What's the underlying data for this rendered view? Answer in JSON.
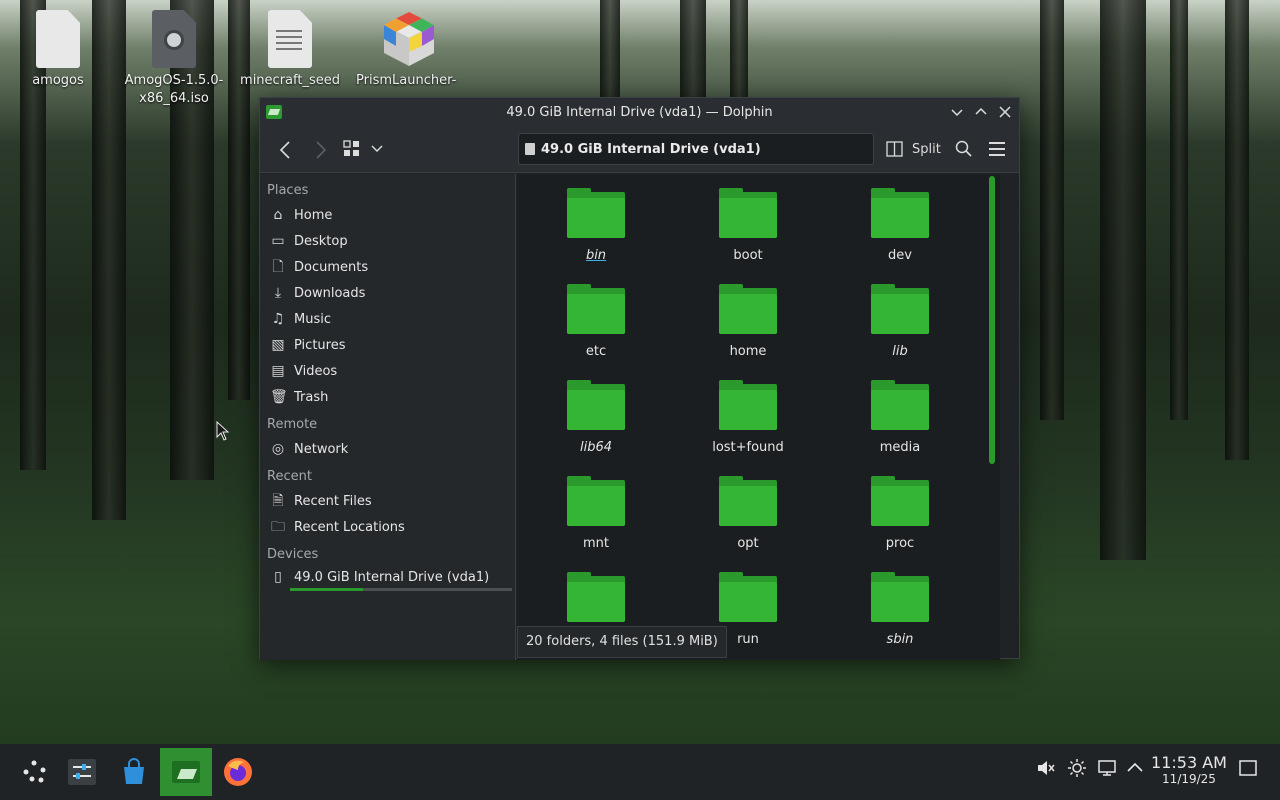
{
  "desktop": {
    "icons": [
      {
        "label": "amogos",
        "icon": "document-icon"
      },
      {
        "label": "AmogOS-1.5.0-x86_64.iso",
        "icon": "disc-image-icon"
      },
      {
        "label": "minecraft_seed",
        "icon": "text-document-icon"
      },
      {
        "label": "PrismLauncher-",
        "icon": "prism-launcher-icon"
      }
    ]
  },
  "window": {
    "title": "49.0 GiB Internal Drive (vda1) — Dolphin",
    "controls": [
      "minimize",
      "maximize",
      "close"
    ]
  },
  "toolbar": {
    "address": "49.0 GiB Internal Drive (vda1)",
    "split_label": "Split"
  },
  "sidebar": {
    "places_title": "Places",
    "places": [
      {
        "label": "Home",
        "icon": "home-icon"
      },
      {
        "label": "Desktop",
        "icon": "desktop-icon"
      },
      {
        "label": "Documents",
        "icon": "documents-icon"
      },
      {
        "label": "Downloads",
        "icon": "downloads-icon"
      },
      {
        "label": "Music",
        "icon": "music-icon"
      },
      {
        "label": "Pictures",
        "icon": "pictures-icon"
      },
      {
        "label": "Videos",
        "icon": "videos-icon"
      },
      {
        "label": "Trash",
        "icon": "trash-icon"
      }
    ],
    "remote_title": "Remote",
    "remote": [
      {
        "label": "Network",
        "icon": "network-icon"
      }
    ],
    "recent_title": "Recent",
    "recent": [
      {
        "label": "Recent Files",
        "icon": "recent-files-icon"
      },
      {
        "label": "Recent Locations",
        "icon": "recent-locations-icon"
      }
    ],
    "devices_title": "Devices",
    "devices": [
      {
        "label": "49.0 GiB Internal Drive (vda1)",
        "icon": "drive-icon",
        "usage_fraction": 0.33
      }
    ]
  },
  "files": [
    {
      "name": "bin",
      "style": "italic-underline"
    },
    {
      "name": "boot",
      "style": "normal"
    },
    {
      "name": "dev",
      "style": "normal"
    },
    {
      "name": "etc",
      "style": "normal"
    },
    {
      "name": "home",
      "style": "normal"
    },
    {
      "name": "lib",
      "style": "italic"
    },
    {
      "name": "lib64",
      "style": "italic"
    },
    {
      "name": "lost+found",
      "style": "normal"
    },
    {
      "name": "media",
      "style": "normal"
    },
    {
      "name": "mnt",
      "style": "normal"
    },
    {
      "name": "opt",
      "style": "normal"
    },
    {
      "name": "proc",
      "style": "normal"
    },
    {
      "name": "",
      "style": "normal"
    },
    {
      "name": "run",
      "style": "normal"
    },
    {
      "name": "sbin",
      "style": "italic"
    }
  ],
  "status": "20 folders, 4 files (151.9 MiB)",
  "taskbar": {
    "apps": [
      "application-launcher-icon",
      "system-settings-icon",
      "discover-store-icon",
      "dolphin-icon",
      "firefox-icon"
    ],
    "tray": [
      "volume-muted-icon",
      "brightness-icon",
      "display-icon",
      "show-hidden-icon"
    ],
    "time": "11:53 AM",
    "date": "11/19/25"
  },
  "colors": {
    "folder": "#35b535",
    "accent": "#2a9a2c",
    "window_bg": "#202326"
  }
}
